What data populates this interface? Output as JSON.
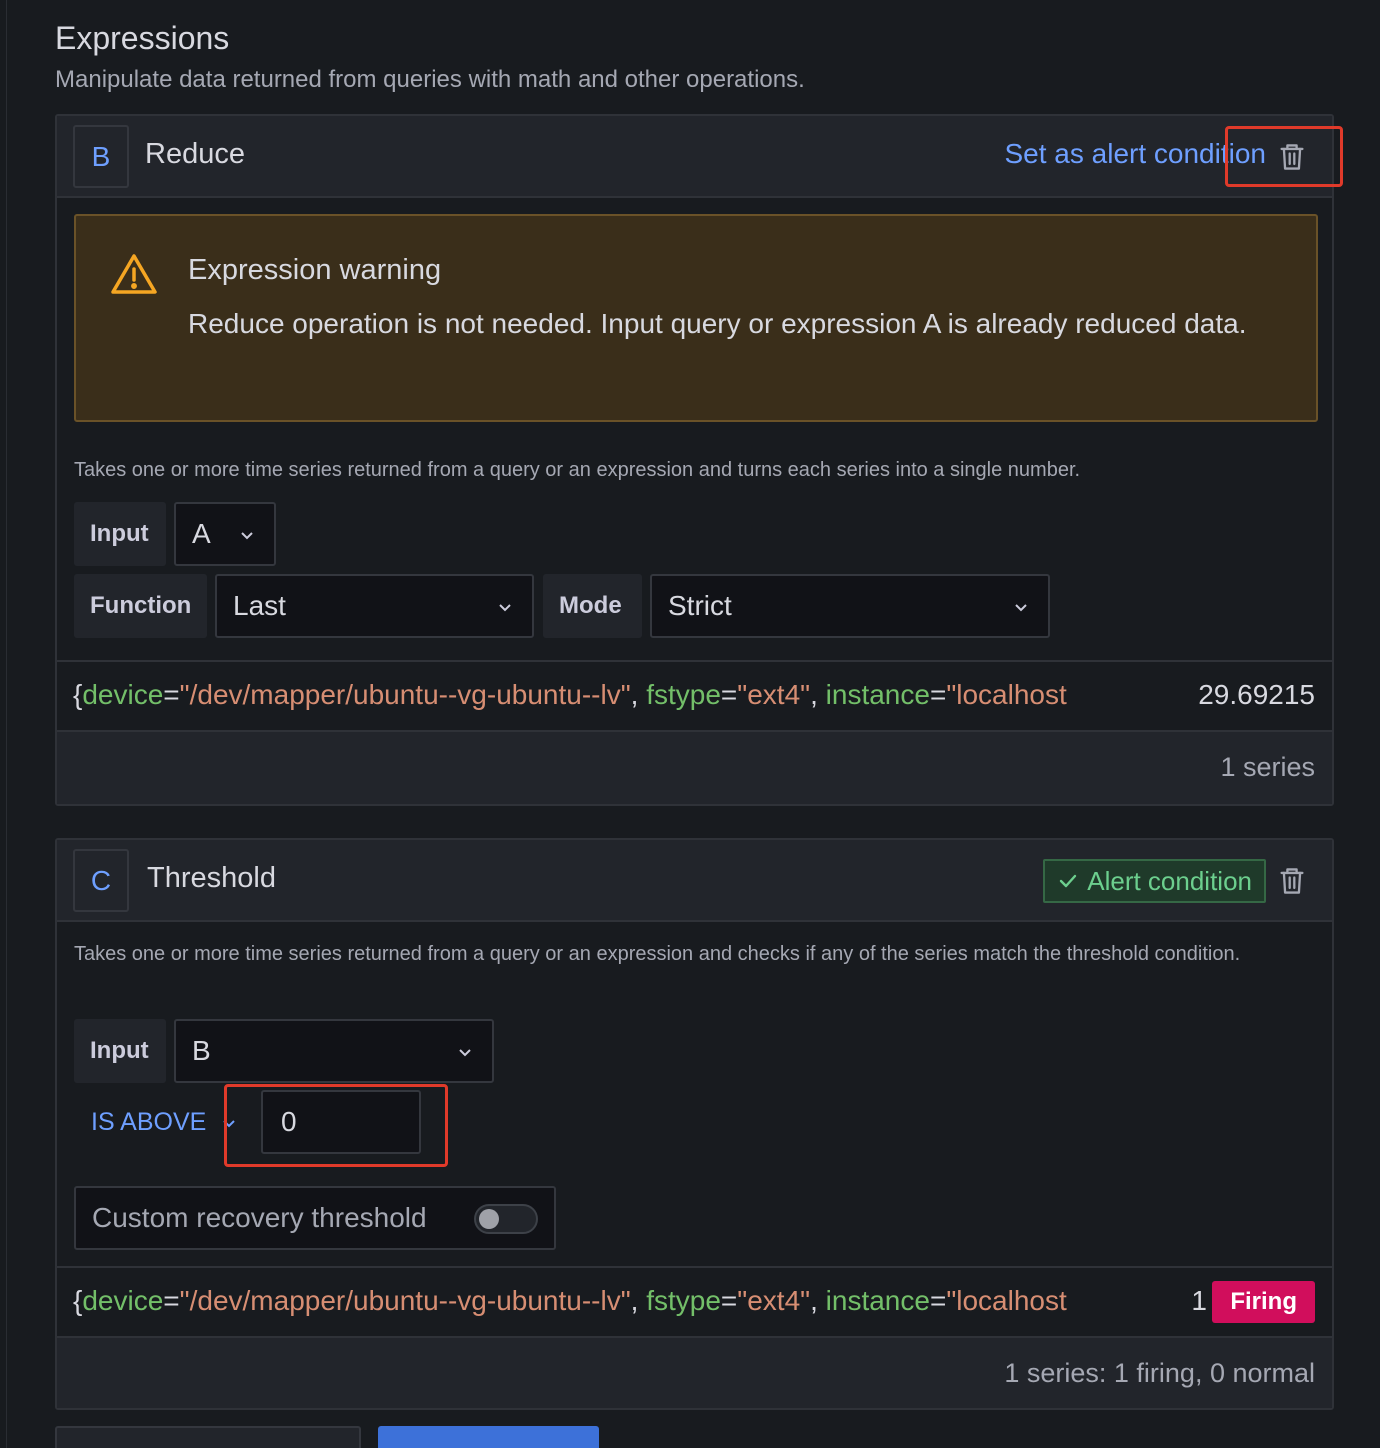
{
  "section": {
    "title": "Expressions",
    "description": "Manipulate data returned from queries with math and other operations."
  },
  "expression_b": {
    "ref": "B",
    "title": "Reduce",
    "set_alert_label": "Set as alert condition",
    "warning": {
      "title": "Expression warning",
      "text": "Reduce operation is not needed. Input query or expression A is already reduced data."
    },
    "description": "Takes one or more time series returned from a query or an expression and turns each series into a single number.",
    "input_label": "Input",
    "input_value": "A",
    "function_label": "Function",
    "function_value": "Last",
    "mode_label": "Mode",
    "mode_value": "Strict",
    "result": {
      "brace": "{",
      "k1": "device",
      "v1": "\"/dev/mapper/ubuntu--vg-ubuntu--lv\"",
      "k2": "fstype",
      "v2": "\"ext4\"",
      "k3": "instance",
      "v3": "\"localhost",
      "value": "29.69215"
    },
    "series_count": "1 series"
  },
  "expression_c": {
    "ref": "C",
    "title": "Threshold",
    "alert_condition_label": "Alert condition",
    "description": "Takes one or more time series returned from a query or an expression and checks if any of the series match the threshold condition.",
    "input_label": "Input",
    "input_value": "B",
    "comparator": "IS ABOVE",
    "threshold_value": "0",
    "recovery_label": "Custom recovery threshold",
    "recovery_enabled": false,
    "result": {
      "brace": "{",
      "k1": "device",
      "v1": "\"/dev/mapper/ubuntu--vg-ubuntu--lv\"",
      "k2": "fstype",
      "v2": "\"ext4\"",
      "k3": "instance",
      "v3": "\"localhost",
      "value": "1",
      "state": "Firing"
    },
    "series_summary": "1 series: 1 firing, 0 normal"
  },
  "colors": {
    "accent_blue": "#6e9fff",
    "warning_bg": "#3a2e1a",
    "firing": "#d10e5c",
    "label_key": "#73bf69",
    "label_value": "#d78e73",
    "highlight_red": "#e03a2a"
  }
}
